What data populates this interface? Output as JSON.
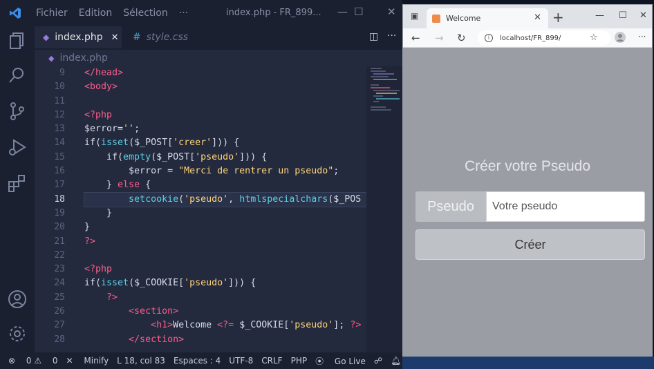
{
  "vscode": {
    "menu": [
      "Fichier",
      "Edition",
      "Sélection",
      "···"
    ],
    "window_title": "index.php - FR_899...",
    "tabs": [
      {
        "label": "index.php",
        "icon": "php-icon",
        "close": "✕"
      },
      {
        "label": "style.css",
        "icon": "css-icon"
      }
    ],
    "breadcrumb": "index.php",
    "line_numbers": [
      "9",
      "10",
      "11",
      "12",
      "13",
      "14",
      "15",
      "16",
      "17",
      "18",
      "19",
      "20",
      "21",
      "22",
      "23",
      "24",
      "25",
      "26",
      "27",
      "28"
    ],
    "current_line": "18",
    "lines": [
      "</head>",
      "<body>",
      "",
      "<?php",
      "$error='';",
      "if(isset($_POST['creer'])) {",
      "    if(empty($_POST['pseudo'])) {",
      "        $error = \"Merci de rentrer un pseudo\";",
      "    } else {",
      "        setcookie('pseudo', htmlspecialchars($_POS",
      "    }",
      "}",
      "?>",
      "",
      "<?php",
      "if(isset($_COOKIE['pseudo'])) {",
      "    ?>",
      "        <section>",
      "            <h1>Welcome <?= $_COOKIE['pseudo']; ?>",
      "        </section>"
    ],
    "status": {
      "errors": "0",
      "warnings": "0",
      "minify": "Minify",
      "position": "L 18, col 83",
      "spaces": "Espaces : 4",
      "encoding": "UTF-8",
      "eol": "CRLF",
      "language": "PHP",
      "golive": "Go Live"
    }
  },
  "browser": {
    "tab_title": "Welcome",
    "url": "localhost/FR_899/",
    "page": {
      "title": "Créer votre Pseudo",
      "addon_label": "Pseudo",
      "input_placeholder": "Votre pseudo",
      "button_label": "Créer"
    }
  },
  "colors": {
    "editor_bg": "#232a3e",
    "page_bg": "#9a9ea4",
    "keyword": "#ff5c8a",
    "function": "#5ccfe6",
    "string": "#ffd479"
  }
}
